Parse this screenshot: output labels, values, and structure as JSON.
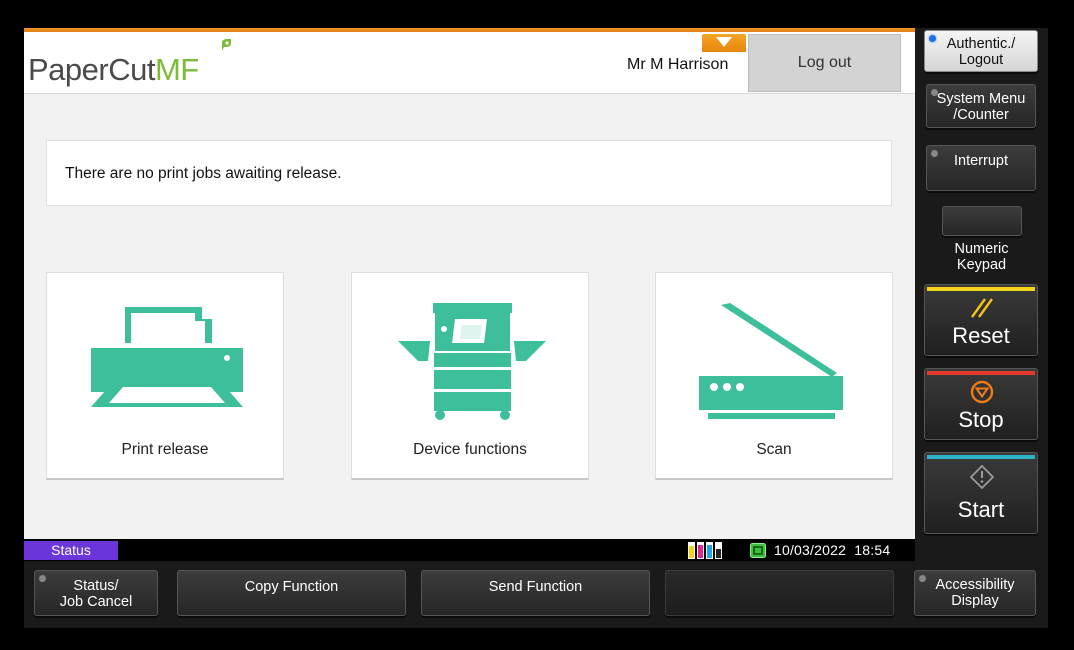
{
  "header": {
    "logo_main": "PaperCut",
    "logo_suffix": "MF",
    "user_name": "Mr M Harrison",
    "logout_label": "Log out"
  },
  "message": "There are no print jobs awaiting release.",
  "tiles": [
    {
      "label": "Print release",
      "icon": "printer-icon"
    },
    {
      "label": "Device functions",
      "icon": "copier-icon"
    },
    {
      "label": "Scan",
      "icon": "scanner-icon"
    }
  ],
  "statusbar": {
    "status_label": "Status",
    "date": "10/03/2022",
    "time": "18:54"
  },
  "side_panel": {
    "auth_line1": "Authentic./",
    "auth_line2": "Logout",
    "sysmenu_line1": "System Menu",
    "sysmenu_line2": "/Counter",
    "interrupt": "Interrupt",
    "keypad_line1": "Numeric",
    "keypad_line2": "Keypad",
    "reset": "Reset",
    "stop": "Stop",
    "start": "Start"
  },
  "bottom_bar": {
    "jobcancel_line1": "Status/",
    "jobcancel_line2": "Job Cancel",
    "copy": "Copy Function",
    "send": "Send Function",
    "access_line1": "Accessibility",
    "access_line2": "Display"
  },
  "colors": {
    "accent_teal": "#3dbf9c",
    "brand_orange": "#f39a2c",
    "brand_green": "#7dbb3a",
    "status_purple": "#6a35d9",
    "reset_yellow": "#f2d21b",
    "stop_red": "#e23b2e",
    "start_cyan": "#2fb3c9"
  }
}
